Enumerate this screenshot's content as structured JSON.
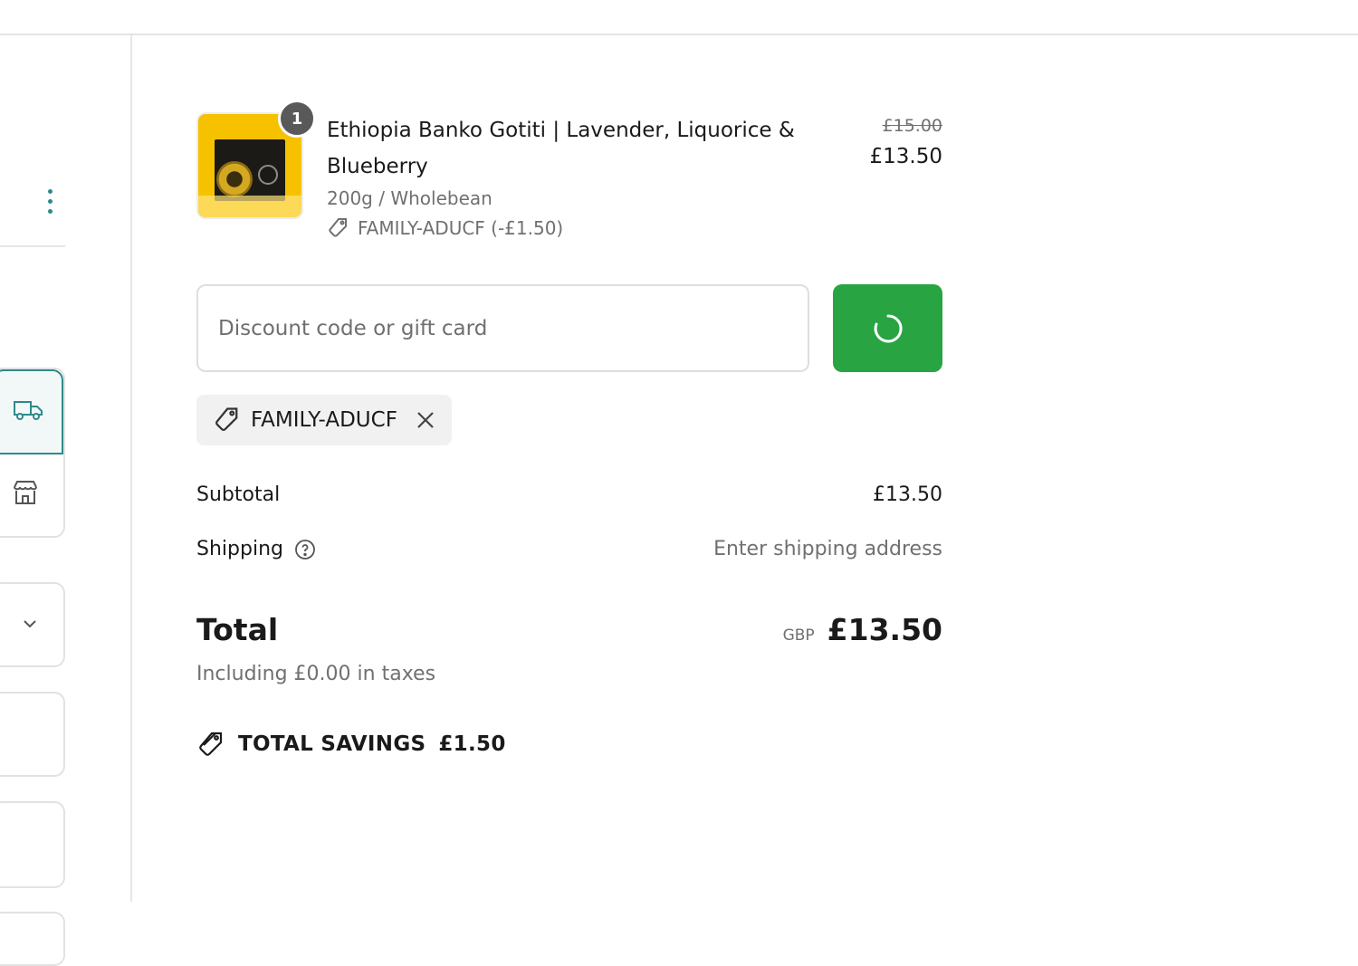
{
  "item": {
    "quantity": "1",
    "title": "Ethiopia Banko Gotiti | Lavender, Liquorice & Blueberry",
    "variant": "200g / Wholebean",
    "discount_line": "FAMILY-ADUCF (-£1.50)",
    "price_original": "£15.00",
    "price_current": "£13.50"
  },
  "discount": {
    "placeholder": "Discount code or gift card",
    "applied_code": "FAMILY-ADUCF"
  },
  "totals": {
    "subtotal_label": "Subtotal",
    "subtotal_value": "£13.50",
    "shipping_label": "Shipping",
    "shipping_value": "Enter shipping address",
    "total_label": "Total",
    "currency": "GBP",
    "total_value": "£13.50",
    "taxes_note": "Including £0.00 in taxes",
    "savings_label": "TOTAL SAVINGS",
    "savings_value": "£1.50"
  },
  "colors": {
    "accent_teal": "#2f8a8a",
    "apply_button_green": "#29a443"
  },
  "icons": {
    "tag": "tag-icon",
    "close": "close-icon",
    "help": "help-circle-icon",
    "spinner": "loading-spinner-icon",
    "truck": "truck-icon",
    "store": "store-icon",
    "chevron": "chevron-down-icon",
    "menu": "more-vertical-icon",
    "savings": "savings-tag-icon"
  }
}
